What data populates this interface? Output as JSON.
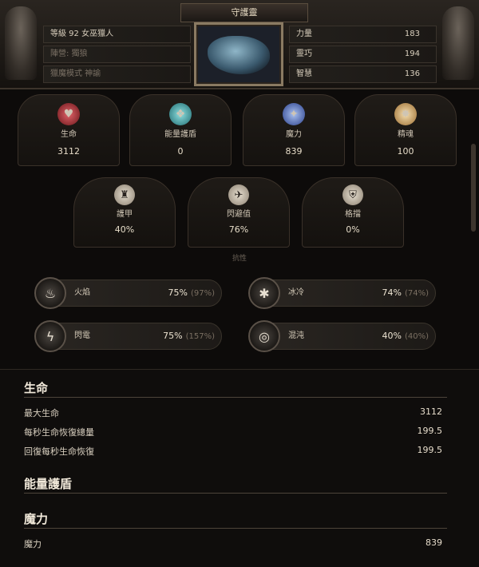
{
  "header": {
    "title": "守護靈",
    "info": [
      {
        "text": "等級 92 女巫獵人",
        "dim": false
      },
      {
        "text": "陣營: 獨狼",
        "dim": true
      },
      {
        "text": "獵魔模式 神諭",
        "dim": true
      }
    ],
    "attributes": [
      {
        "label": "力量",
        "value": "183"
      },
      {
        "label": "靈巧",
        "value": "194"
      },
      {
        "label": "智慧",
        "value": "136"
      }
    ]
  },
  "stats": [
    {
      "label": "生命",
      "value": "3112",
      "icon": "heart-icon",
      "color": "#b8323a"
    },
    {
      "label": "能量護盾",
      "value": "0",
      "icon": "shield-energy-icon",
      "color": "#3aa7a8"
    },
    {
      "label": "魔力",
      "value": "839",
      "icon": "mana-icon",
      "color": "#4a6fd0"
    },
    {
      "label": "精魂",
      "value": "100",
      "icon": "spirit-icon",
      "color": "#e0b870"
    }
  ],
  "defenses": [
    {
      "label": "護甲",
      "value": "40%",
      "icon": "armor-icon"
    },
    {
      "label": "閃避值",
      "value": "76%",
      "icon": "evasion-icon"
    },
    {
      "label": "格擋",
      "value": "0%",
      "icon": "block-icon"
    }
  ],
  "resist_caption": "抗性",
  "resistances": [
    {
      "label": "火焰",
      "value": "75%",
      "sub": "(97%)",
      "icon": "fire-icon"
    },
    {
      "label": "冰冷",
      "value": "74%",
      "sub": "(74%)",
      "icon": "cold-icon"
    },
    {
      "label": "閃電",
      "value": "75%",
      "sub": "(157%)",
      "icon": "lightning-icon"
    },
    {
      "label": "混沌",
      "value": "40%",
      "sub": "(40%)",
      "icon": "chaos-icon"
    }
  ],
  "sections": {
    "life": {
      "title": "生命",
      "rows": [
        {
          "label": "最大生命",
          "value": "3112"
        },
        {
          "label": "每秒生命恢復總量",
          "value": "199.5"
        },
        {
          "label": "回復每秒生命恢復",
          "value": "199.5"
        }
      ]
    },
    "energy_shield": {
      "title": "能量護盾"
    },
    "mana": {
      "title": "魔力",
      "rows": [
        {
          "label": "魔力",
          "value": "839"
        }
      ]
    }
  }
}
